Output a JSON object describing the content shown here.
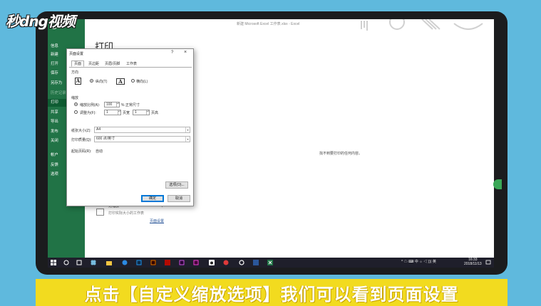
{
  "watermark": "秒dng视频",
  "app": {
    "top_status": "新建 Microsoft Excel 工作表.xlsx  -  Excel",
    "sidebar": {
      "items": [
        {
          "label": "信息"
        },
        {
          "label": "新建"
        },
        {
          "label": "打开"
        },
        {
          "label": "保存"
        },
        {
          "label": "另存为"
        },
        {
          "label": "历史记录"
        },
        {
          "label": "打印"
        },
        {
          "label": "共享"
        },
        {
          "label": "导出"
        },
        {
          "label": "发布"
        },
        {
          "label": "关闭"
        },
        {
          "label": "帐户"
        },
        {
          "label": "反馈"
        },
        {
          "label": "选项"
        }
      ],
      "active": "打印"
    },
    "main": {
      "title": "打印",
      "empty_message": "找不到要打印的任何内容。",
      "scaling_name": "无缩放",
      "scaling_desc": "打印实际大小的工作表",
      "page_setup_link": "页面设置"
    }
  },
  "dialog": {
    "title": "页面设置",
    "help": "?",
    "close": "×",
    "tabs": [
      "页面",
      "页边距",
      "页眉/页脚",
      "工作表"
    ],
    "active_tab": "页面",
    "orientation_label": "方向",
    "portrait_label": "纵向(T)",
    "landscape_label": "横向(L)",
    "portrait_glyph": "A",
    "landscape_glyph": "A",
    "scaling_label": "缩放",
    "adjust_label": "缩放比例(A):",
    "adjust_value": "100",
    "adjust_unit": "% 正常尺寸",
    "fit_label": "调整为(F):",
    "fit_wide_value": "1",
    "fit_wide_unit": "页宽",
    "fit_tall_value": "1",
    "fit_tall_unit": "页高",
    "paper_size_label": "纸张大小(Z):",
    "paper_size_value": "A4",
    "print_quality_label": "打印质量(Q):",
    "print_quality_value": "600 点/英寸",
    "first_page_label": "起始页码(R):",
    "first_page_value": "自动",
    "options_button": "选项(O)...",
    "ok_button": "确定",
    "cancel_button": "取消"
  },
  "taskbar": {
    "apps": [
      "start",
      "search",
      "task-view",
      "excel-green",
      "files",
      "edge",
      "photoshop",
      "illustrator",
      "acrobat",
      "premiere",
      "adobe-xd",
      "app-a",
      "app-b",
      "app-c",
      "excel"
    ],
    "tray_text": "^ ☁ ⌨ 中 ☼ ◁ ))) 英",
    "time": "16:33",
    "date": "2018/11/13"
  },
  "caption": "点击【自定义缩放选项】我们可以看到页面设置",
  "colors": {
    "background": "#5fb9dd",
    "excel_green": "#217346",
    "caption_yellow": "#f2db1f",
    "taskbar": "#1f1f2b"
  }
}
